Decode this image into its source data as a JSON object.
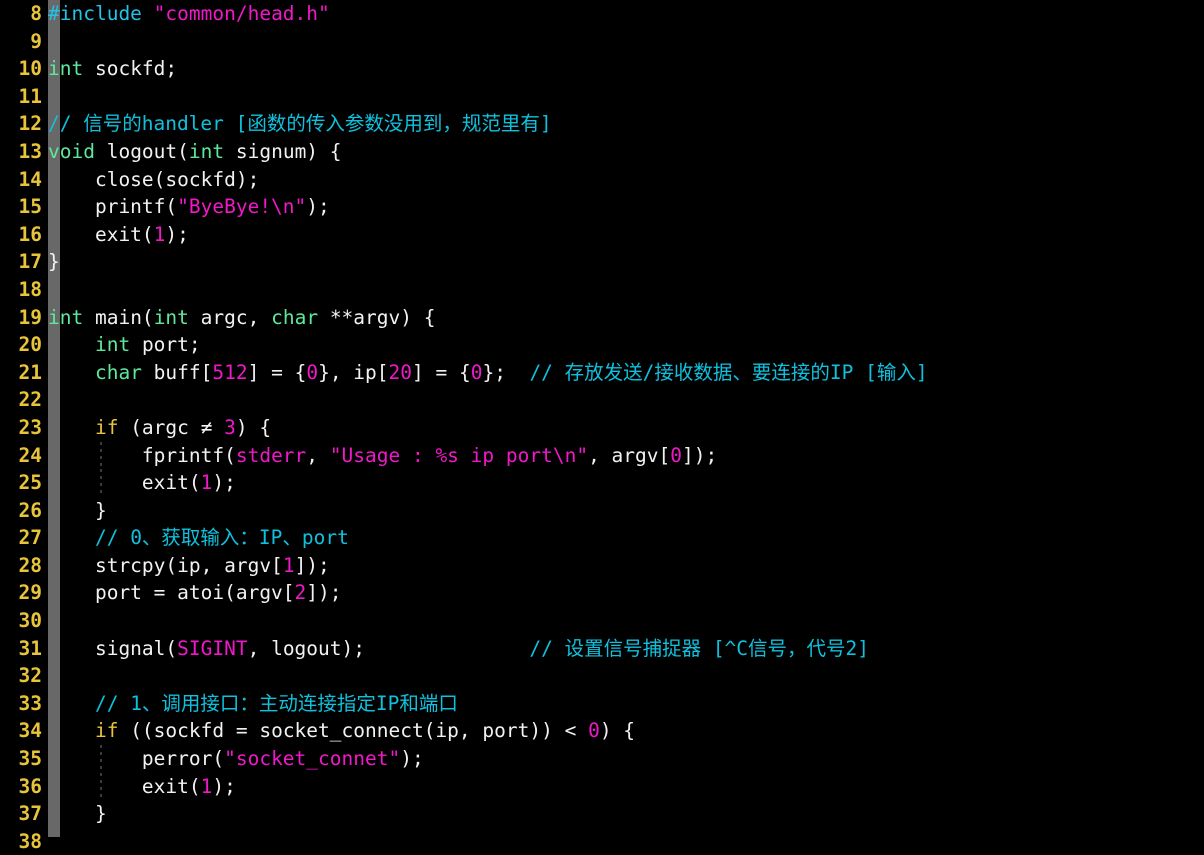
{
  "editor": {
    "background_color": "#000000",
    "gutter_strip_color": "#686868",
    "line_number_color": "#E8C43A",
    "default_text_color": "#F2F2F2",
    "font_size_px": 19.5,
    "line_height_px": 27.6,
    "first_visible_line": 8,
    "last_visible_line": 38,
    "language": "C"
  },
  "palette": {
    "preprocessor": "#22C3E6",
    "string": "#F018C8",
    "type": "#5EE89B",
    "keyword": "#E8C43A",
    "number": "#F018C8",
    "constant": "#F018C8",
    "comment": "#0FC1DE",
    "plain": "#F2F2F2"
  },
  "lines": [
    {
      "number": "8",
      "indent_guides": [],
      "tokens": [
        {
          "text": "#include",
          "cls": "tok-preproc"
        },
        {
          "text": " ",
          "cls": "tok-plain"
        },
        {
          "text": "\"common/head.h\"",
          "cls": "tok-string"
        }
      ]
    },
    {
      "number": "9",
      "indent_guides": [],
      "tokens": []
    },
    {
      "number": "10",
      "indent_guides": [],
      "tokens": [
        {
          "text": "int",
          "cls": "tok-type"
        },
        {
          "text": " sockfd;",
          "cls": "tok-plain"
        }
      ]
    },
    {
      "number": "11",
      "indent_guides": [],
      "tokens": []
    },
    {
      "number": "12",
      "indent_guides": [],
      "tokens": [
        {
          "text": "// 信号的handler [函数的传入参数没用到，规范里有]",
          "cls": "tok-comment"
        }
      ]
    },
    {
      "number": "13",
      "indent_guides": [],
      "tokens": [
        {
          "text": "void",
          "cls": "tok-type"
        },
        {
          "text": " logout(",
          "cls": "tok-plain"
        },
        {
          "text": "int",
          "cls": "tok-type"
        },
        {
          "text": " signum) {",
          "cls": "tok-plain"
        }
      ]
    },
    {
      "number": "14",
      "indent_guides": [],
      "tokens": [
        {
          "text": "    close(sockfd);",
          "cls": "tok-plain"
        }
      ]
    },
    {
      "number": "15",
      "indent_guides": [],
      "tokens": [
        {
          "text": "    printf(",
          "cls": "tok-plain"
        },
        {
          "text": "\"ByeBye!\\n\"",
          "cls": "tok-string"
        },
        {
          "text": ");",
          "cls": "tok-plain"
        }
      ]
    },
    {
      "number": "16",
      "indent_guides": [],
      "tokens": [
        {
          "text": "    exit(",
          "cls": "tok-plain"
        },
        {
          "text": "1",
          "cls": "tok-number"
        },
        {
          "text": ");",
          "cls": "tok-plain"
        }
      ]
    },
    {
      "number": "17",
      "indent_guides": [],
      "tokens": [
        {
          "text": "}",
          "cls": "tok-plain"
        }
      ]
    },
    {
      "number": "18",
      "indent_guides": [],
      "tokens": []
    },
    {
      "number": "19",
      "indent_guides": [],
      "tokens": [
        {
          "text": "int",
          "cls": "tok-type"
        },
        {
          "text": " main(",
          "cls": "tok-plain"
        },
        {
          "text": "int",
          "cls": "tok-type"
        },
        {
          "text": " argc, ",
          "cls": "tok-plain"
        },
        {
          "text": "char",
          "cls": "tok-type"
        },
        {
          "text": " **argv) {",
          "cls": "tok-plain"
        }
      ]
    },
    {
      "number": "20",
      "indent_guides": [],
      "tokens": [
        {
          "text": "    ",
          "cls": "tok-plain"
        },
        {
          "text": "int",
          "cls": "tok-type"
        },
        {
          "text": " port;",
          "cls": "tok-plain"
        }
      ]
    },
    {
      "number": "21",
      "indent_guides": [],
      "tokens": [
        {
          "text": "    ",
          "cls": "tok-plain"
        },
        {
          "text": "char",
          "cls": "tok-type"
        },
        {
          "text": " buff[",
          "cls": "tok-plain"
        },
        {
          "text": "512",
          "cls": "tok-number"
        },
        {
          "text": "] = {",
          "cls": "tok-plain"
        },
        {
          "text": "0",
          "cls": "tok-number"
        },
        {
          "text": "}, ip[",
          "cls": "tok-plain"
        },
        {
          "text": "20",
          "cls": "tok-number"
        },
        {
          "text": "] = {",
          "cls": "tok-plain"
        },
        {
          "text": "0",
          "cls": "tok-number"
        },
        {
          "text": "};  ",
          "cls": "tok-plain"
        },
        {
          "text": "// 存放发送/接收数据、要连接的IP [输入]",
          "cls": "tok-comment"
        }
      ]
    },
    {
      "number": "22",
      "indent_guides": [],
      "tokens": []
    },
    {
      "number": "23",
      "indent_guides": [],
      "tokens": [
        {
          "text": "    ",
          "cls": "tok-plain"
        },
        {
          "text": "if",
          "cls": "tok-keyword"
        },
        {
          "text": " (argc ≠ ",
          "cls": "tok-plain"
        },
        {
          "text": "3",
          "cls": "tok-number"
        },
        {
          "text": ") {",
          "cls": "tok-plain"
        }
      ]
    },
    {
      "number": "24",
      "indent_guides": [
        100
      ],
      "tokens": [
        {
          "text": "        fprintf(",
          "cls": "tok-plain"
        },
        {
          "text": "stderr",
          "cls": "tok-const"
        },
        {
          "text": ", ",
          "cls": "tok-plain"
        },
        {
          "text": "\"Usage : %s ip port\\n\"",
          "cls": "tok-string"
        },
        {
          "text": ", argv[",
          "cls": "tok-plain"
        },
        {
          "text": "0",
          "cls": "tok-number"
        },
        {
          "text": "]);",
          "cls": "tok-plain"
        }
      ]
    },
    {
      "number": "25",
      "indent_guides": [
        100
      ],
      "tokens": [
        {
          "text": "        exit(",
          "cls": "tok-plain"
        },
        {
          "text": "1",
          "cls": "tok-number"
        },
        {
          "text": ");",
          "cls": "tok-plain"
        }
      ]
    },
    {
      "number": "26",
      "indent_guides": [],
      "tokens": [
        {
          "text": "    }",
          "cls": "tok-plain"
        }
      ]
    },
    {
      "number": "27",
      "indent_guides": [],
      "tokens": [
        {
          "text": "    ",
          "cls": "tok-plain"
        },
        {
          "text": "// 0、获取输入：IP、port",
          "cls": "tok-comment"
        }
      ]
    },
    {
      "number": "28",
      "indent_guides": [],
      "tokens": [
        {
          "text": "    strcpy(ip, argv[",
          "cls": "tok-plain"
        },
        {
          "text": "1",
          "cls": "tok-number"
        },
        {
          "text": "]);",
          "cls": "tok-plain"
        }
      ]
    },
    {
      "number": "29",
      "indent_guides": [],
      "tokens": [
        {
          "text": "    port = atoi(argv[",
          "cls": "tok-plain"
        },
        {
          "text": "2",
          "cls": "tok-number"
        },
        {
          "text": "]);",
          "cls": "tok-plain"
        }
      ]
    },
    {
      "number": "30",
      "indent_guides": [],
      "tokens": []
    },
    {
      "number": "31",
      "indent_guides": [],
      "tokens": [
        {
          "text": "    signal(",
          "cls": "tok-plain"
        },
        {
          "text": "SIGINT",
          "cls": "tok-const"
        },
        {
          "text": ", logout);              ",
          "cls": "tok-plain"
        },
        {
          "text": "// 设置信号捕捉器 [^C信号，代号2]",
          "cls": "tok-comment"
        }
      ]
    },
    {
      "number": "32",
      "indent_guides": [],
      "tokens": []
    },
    {
      "number": "33",
      "indent_guides": [],
      "tokens": [
        {
          "text": "    ",
          "cls": "tok-plain"
        },
        {
          "text": "// 1、调用接口：主动连接指定IP和端口",
          "cls": "tok-comment"
        }
      ]
    },
    {
      "number": "34",
      "indent_guides": [],
      "tokens": [
        {
          "text": "    ",
          "cls": "tok-plain"
        },
        {
          "text": "if",
          "cls": "tok-keyword"
        },
        {
          "text": " ((sockfd = socket_connect(ip, port)) < ",
          "cls": "tok-plain"
        },
        {
          "text": "0",
          "cls": "tok-number"
        },
        {
          "text": ") {",
          "cls": "tok-plain"
        }
      ]
    },
    {
      "number": "35",
      "indent_guides": [
        100
      ],
      "tokens": [
        {
          "text": "        perror(",
          "cls": "tok-plain"
        },
        {
          "text": "\"socket_connet\"",
          "cls": "tok-string"
        },
        {
          "text": ");",
          "cls": "tok-plain"
        }
      ]
    },
    {
      "number": "36",
      "indent_guides": [
        100
      ],
      "tokens": [
        {
          "text": "        exit(",
          "cls": "tok-plain"
        },
        {
          "text": "1",
          "cls": "tok-number"
        },
        {
          "text": ");",
          "cls": "tok-plain"
        }
      ]
    },
    {
      "number": "37",
      "indent_guides": [],
      "tokens": [
        {
          "text": "    }",
          "cls": "tok-plain"
        }
      ]
    },
    {
      "number": "38",
      "indent_guides": [],
      "tokens": []
    }
  ]
}
